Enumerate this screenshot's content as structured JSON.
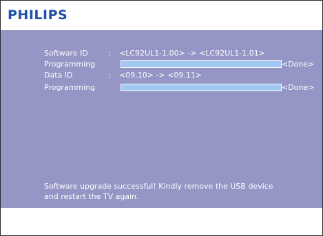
{
  "brand": {
    "logo_text": "PHILIPS",
    "logo_color": "#1f4fa8"
  },
  "colors": {
    "panel_background": "#9595c6",
    "progress_fill": "#9fc9f3",
    "text": "#ffffff"
  },
  "upgrade": {
    "software": {
      "label": "Software ID",
      "colon": ":",
      "value": "<LC92UL1-1.00> -> <LC92UL1-1.01>"
    },
    "software_programming": {
      "label": "Programming",
      "progress": 1.0,
      "status": "<Done>"
    },
    "data": {
      "label": "Data ID",
      "colon": ":",
      "value": "<09.10> -> <09.11>"
    },
    "data_programming": {
      "label": "Programming",
      "progress": 1.0,
      "status": "<Done>"
    }
  },
  "message": {
    "line1": "Software upgrade successful! Kindly remove the USB device",
    "line2": "and restart the TV again."
  }
}
